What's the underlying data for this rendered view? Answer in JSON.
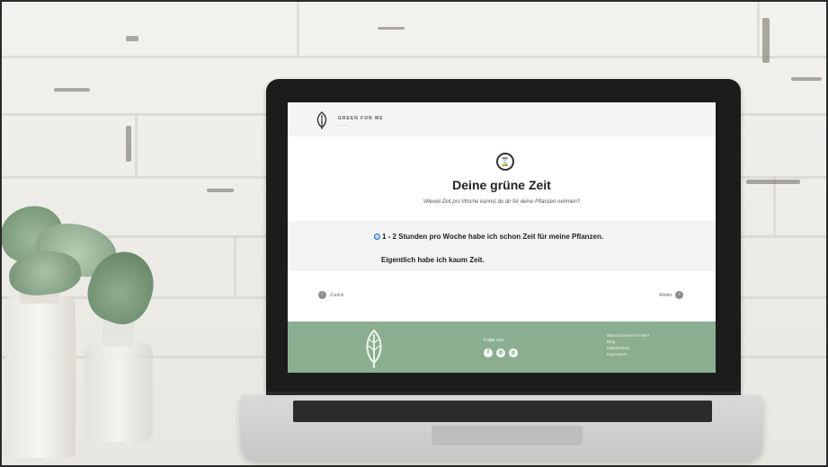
{
  "site": {
    "brand": "GREEN FOR ME",
    "brand_sub": "———",
    "logo_icon": "leaf-icon"
  },
  "quiz": {
    "badge_icon": "clock-icon",
    "badge_glyph": "⌛",
    "title": "Deine grüne Zeit",
    "subtitle": "Wieviel Zeit pro Woche kannst du dir für deine Pflanzen nehmen?",
    "options": [
      "1 - 2 Stunden pro Woche habe ich schon Zeit für meine Pflanzen.",
      "Eigentlich habe ich kaum Zeit."
    ],
    "selected_index": 0,
    "back_label": "Zurück",
    "next_label": "Weiter"
  },
  "footer": {
    "follow_label": "Folge uns",
    "social_icons": [
      "facebook-icon",
      "instagram-icon",
      "pinterest-icon"
    ],
    "social_glyphs": [
      "f",
      "◎",
      "p"
    ],
    "links": [
      "Was ist Green For Me?",
      "Blog",
      "Datenschutz",
      "Impressum"
    ]
  },
  "colors": {
    "footer_green": "#8aae8f",
    "bezel": "#1c1c1d",
    "wall": "#f0efeb"
  }
}
